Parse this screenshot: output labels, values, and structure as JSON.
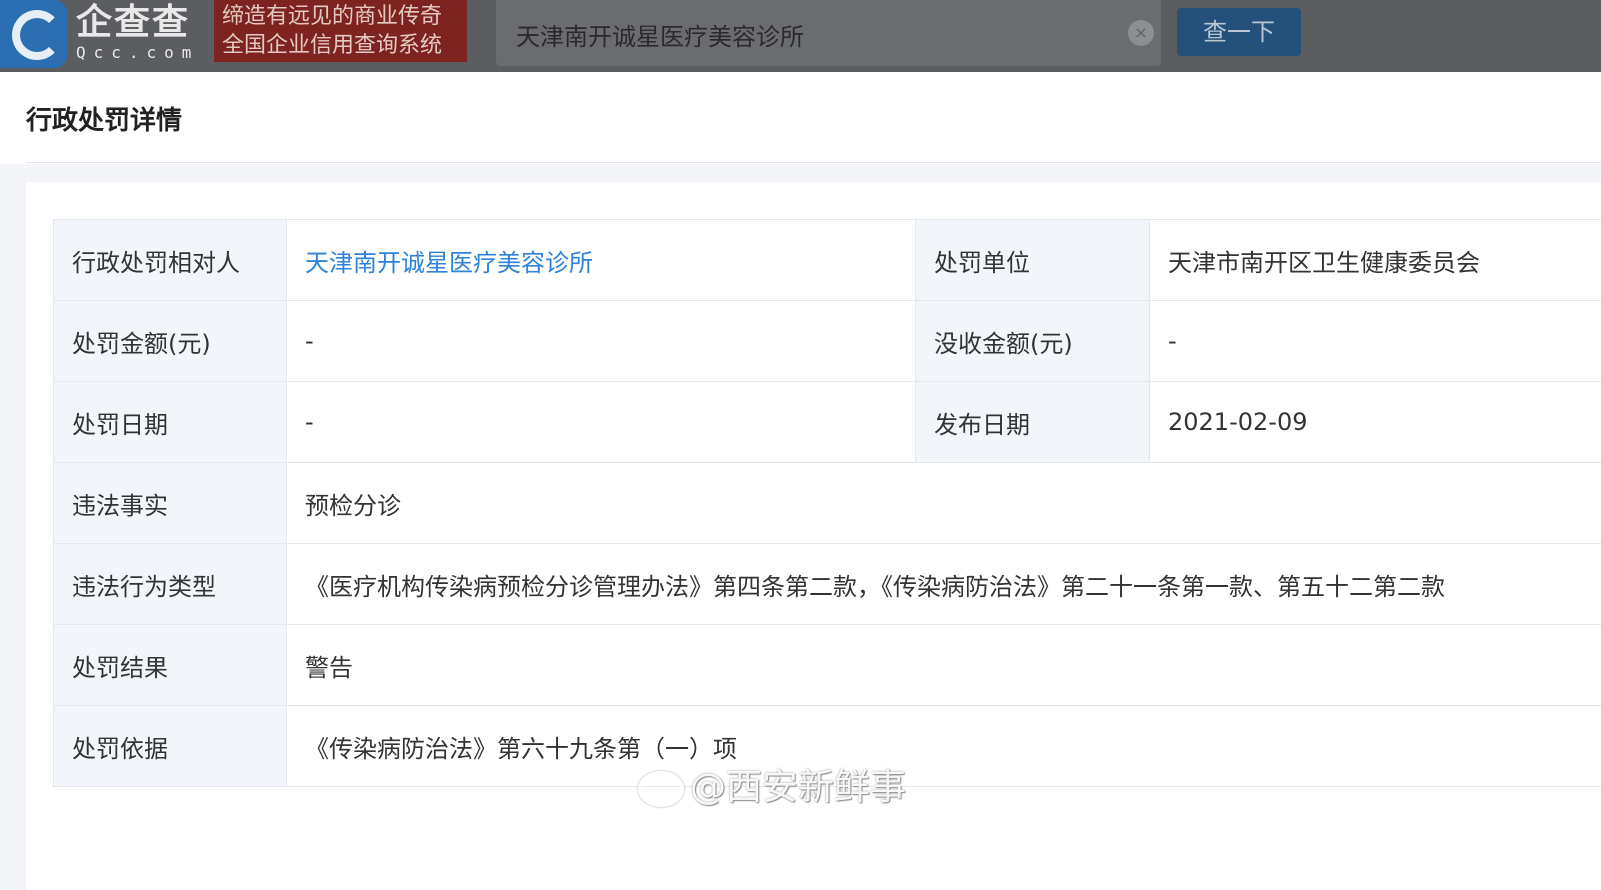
{
  "header": {
    "logo_cn": "企查查",
    "logo_en": "Qcc.com",
    "slogan_line1": "缔造有远见的商业传奇",
    "slogan_line2": "全国企业信用查询系统",
    "search_value": "天津南开诚星医疗美容诊所",
    "search_button": "查一下",
    "clear_icon": "×"
  },
  "page": {
    "title": "行政处罚详情"
  },
  "details": {
    "party_label": "行政处罚相对人",
    "party_value": "天津南开诚星医疗美容诊所",
    "unit_label": "处罚单位",
    "unit_value": "天津市南开区卫生健康委员会",
    "amount_label": "处罚金额(元)",
    "amount_value": "-",
    "confiscated_label": "没收金额(元)",
    "confiscated_value": "-",
    "penalty_date_label": "处罚日期",
    "penalty_date_value": "-",
    "publish_date_label": "发布日期",
    "publish_date_value": "2021-02-09",
    "facts_label": "违法事实",
    "facts_value": "预检分诊",
    "violation_type_label": "违法行为类型",
    "violation_type_value": "《医疗机构传染病预检分诊管理办法》第四条第二款，《传染病防治法》第二十一条第一款、第五十二第二款",
    "result_label": "处罚结果",
    "result_value": "警告",
    "basis_label": "处罚依据",
    "basis_value": "《传染病防治法》第六十九条第（一）项"
  },
  "watermark": {
    "text": "@西安新鲜事"
  },
  "colors": {
    "link": "#2d83d8",
    "label_bg": "#f2f6fb",
    "topbar": "#5b5d61"
  }
}
